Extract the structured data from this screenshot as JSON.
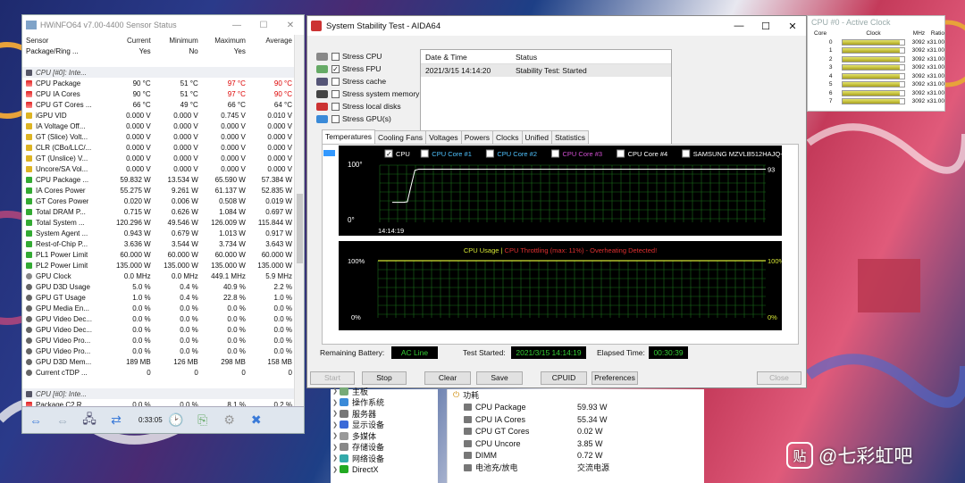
{
  "hwinfo": {
    "title": "HWiNFO64 v7.00-4400 Sensor Status",
    "cols": [
      "Sensor",
      "Current",
      "Minimum",
      "Maximum",
      "Average"
    ],
    "rows": [
      {
        "k": "h",
        "c": [
          "Package/Ring ...",
          "Yes",
          "No",
          "Yes",
          ""
        ]
      },
      {
        "k": "sp",
        "c": [
          "",
          "",
          "",
          "",
          ""
        ]
      },
      {
        "k": "g",
        "c": [
          "CPU [#0]: Inte...",
          "",
          "",
          "",
          ""
        ]
      },
      {
        "k": "t",
        "r": 1,
        "c": [
          "CPU Package",
          "90 °C",
          "51 °C",
          "97 °C",
          "90 °C"
        ]
      },
      {
        "k": "t",
        "r": 1,
        "c": [
          "CPU IA Cores",
          "90 °C",
          "51 °C",
          "97 °C",
          "90 °C"
        ]
      },
      {
        "k": "t",
        "c": [
          "CPU GT Cores ...",
          "66 °C",
          "49 °C",
          "66 °C",
          "64 °C"
        ]
      },
      {
        "k": "v",
        "c": [
          "iGPU VID",
          "0.000 V",
          "0.000 V",
          "0.745 V",
          "0.010 V"
        ]
      },
      {
        "k": "v",
        "c": [
          "IA Voltage Off...",
          "0.000 V",
          "0.000 V",
          "0.000 V",
          "0.000 V"
        ]
      },
      {
        "k": "v",
        "c": [
          "GT (Slice) Volt...",
          "0.000 V",
          "0.000 V",
          "0.000 V",
          "0.000 V"
        ]
      },
      {
        "k": "v",
        "c": [
          "CLR (CBo/LLC/...",
          "0.000 V",
          "0.000 V",
          "0.000 V",
          "0.000 V"
        ]
      },
      {
        "k": "v",
        "c": [
          "GT (Unslice) V...",
          "0.000 V",
          "0.000 V",
          "0.000 V",
          "0.000 V"
        ]
      },
      {
        "k": "v",
        "c": [
          "Uncore/SA Vol...",
          "0.000 V",
          "0.000 V",
          "0.000 V",
          "0.000 V"
        ]
      },
      {
        "k": "p",
        "c": [
          "CPU Package ...",
          "59.832 W",
          "13.534 W",
          "65.590 W",
          "57.384 W"
        ]
      },
      {
        "k": "p",
        "c": [
          "IA Cores Power",
          "55.275 W",
          "9.261 W",
          "61.137 W",
          "52.835 W"
        ]
      },
      {
        "k": "p",
        "c": [
          "GT Cores Power",
          "0.020 W",
          "0.006 W",
          "0.508 W",
          "0.019 W"
        ]
      },
      {
        "k": "p",
        "c": [
          "Total DRAM P...",
          "0.715 W",
          "0.626 W",
          "1.084 W",
          "0.697 W"
        ]
      },
      {
        "k": "p",
        "c": [
          "Total System ...",
          "120.296 W",
          "49.546 W",
          "126.009 W",
          "115.844 W"
        ]
      },
      {
        "k": "p",
        "c": [
          "System Agent ...",
          "0.943 W",
          "0.679 W",
          "1.013 W",
          "0.917 W"
        ]
      },
      {
        "k": "p",
        "c": [
          "Rest-of-Chip P...",
          "3.636 W",
          "3.544 W",
          "3.734 W",
          "3.643 W"
        ]
      },
      {
        "k": "p",
        "c": [
          "PL1 Power Limit",
          "60.000 W",
          "60.000 W",
          "60.000 W",
          "60.000 W"
        ]
      },
      {
        "k": "p",
        "c": [
          "PL2 Power Limit",
          "135.000 W",
          "135.000 W",
          "135.000 W",
          "135.000 W"
        ]
      },
      {
        "k": "c",
        "c": [
          "GPU Clock",
          "0.0 MHz",
          "0.0 MHz",
          "449.1 MHz",
          "5.9 MHz"
        ]
      },
      {
        "k": "u",
        "c": [
          "GPU D3D Usage",
          "5.0 %",
          "0.4 %",
          "40.9 %",
          "2.2 %"
        ]
      },
      {
        "k": "u",
        "c": [
          "GPU GT Usage",
          "1.0 %",
          "0.4 %",
          "22.8 %",
          "1.0 %"
        ]
      },
      {
        "k": "u",
        "c": [
          "GPU Media En...",
          "0.0 %",
          "0.0 %",
          "0.0 %",
          "0.0 %"
        ]
      },
      {
        "k": "u",
        "c": [
          "GPU Video Dec...",
          "0.0 %",
          "0.0 %",
          "0.0 %",
          "0.0 %"
        ]
      },
      {
        "k": "u",
        "c": [
          "GPU Video Dec...",
          "0.0 %",
          "0.0 %",
          "0.0 %",
          "0.0 %"
        ]
      },
      {
        "k": "u",
        "c": [
          "GPU Video Pro...",
          "0.0 %",
          "0.0 %",
          "0.0 %",
          "0.0 %"
        ]
      },
      {
        "k": "u",
        "c": [
          "GPU Video Pro...",
          "0.0 %",
          "0.0 %",
          "0.0 %",
          "0.0 %"
        ]
      },
      {
        "k": "u",
        "c": [
          "GPU D3D Mem...",
          "189 MB",
          "126 MB",
          "298 MB",
          "158 MB"
        ]
      },
      {
        "k": "u",
        "c": [
          "Current cTDP ...",
          "0",
          "0",
          "0",
          "0"
        ]
      },
      {
        "k": "sp",
        "c": [
          "",
          "",
          "",
          "",
          ""
        ]
      },
      {
        "k": "g",
        "c": [
          "CPU [#0]: Inte...",
          "",
          "",
          "",
          ""
        ]
      },
      {
        "k": "t",
        "c": [
          "Package C2 R...",
          "0.0 %",
          "0.0 %",
          "8.1 %",
          "0.2 %"
        ]
      }
    ],
    "timer": "0:33:05"
  },
  "clock": {
    "title": "CPU #0 - Active Clock",
    "cols": [
      "Core",
      "Clock",
      "MHz",
      "Ratio"
    ],
    "rows": [
      [
        "0",
        "3092",
        "x31.00"
      ],
      [
        "1",
        "3092",
        "x31.00"
      ],
      [
        "2",
        "3092",
        "x31.00"
      ],
      [
        "3",
        "3092",
        "x31.00"
      ],
      [
        "4",
        "3092",
        "x31.00"
      ],
      [
        "5",
        "3092",
        "x31.00"
      ],
      [
        "6",
        "3092",
        "x31.00"
      ],
      [
        "7",
        "3092",
        "x31.00"
      ]
    ]
  },
  "aida": {
    "title": "System Stability Test - AIDA64",
    "stress": [
      {
        "label": "Stress CPU",
        "checked": false
      },
      {
        "label": "Stress FPU",
        "checked": true
      },
      {
        "label": "Stress cache",
        "checked": false
      },
      {
        "label": "Stress system memory",
        "checked": false
      },
      {
        "label": "Stress local disks",
        "checked": false
      },
      {
        "label": "Stress GPU(s)",
        "checked": false
      }
    ],
    "log_cols": [
      "Date & Time",
      "Status"
    ],
    "log_rows": [
      [
        "2021/3/15 14:14:20",
        "Stability Test: Started"
      ]
    ],
    "tabs": [
      "Temperatures",
      "Cooling Fans",
      "Voltages",
      "Powers",
      "Clocks",
      "Unified",
      "Statistics"
    ],
    "legend": [
      {
        "label": "CPU",
        "color": "#ffffff",
        "checked": true
      },
      {
        "label": "CPU Core #1",
        "color": "#4fc3ff",
        "checked": false
      },
      {
        "label": "CPU Core #2",
        "color": "#4fc3ff",
        "checked": false
      },
      {
        "label": "CPU Core #3",
        "color": "#d24fd2",
        "checked": false
      },
      {
        "label": "CPU Core #4",
        "color": "#ffffff",
        "checked": false
      },
      {
        "label": "SAMSUNG MZVLB512HAJQ-00000",
        "color": "#ffffff",
        "checked": false
      }
    ],
    "temp_chart": {
      "ymax": "100",
      "yunit": "°C",
      "ymin": "0",
      "xlabel": "14:14:19",
      "value_label": "93",
      "series": [
        35,
        35,
        35,
        35,
        36,
        64,
        91,
        93,
        93,
        93,
        93,
        93,
        93,
        93,
        93,
        93,
        93,
        93,
        93,
        93,
        93,
        93,
        93,
        93,
        93,
        93,
        93,
        93,
        93,
        93,
        93,
        93,
        93,
        93,
        93,
        93,
        93,
        93,
        93,
        93,
        93,
        93,
        93,
        93,
        93,
        93,
        93,
        93,
        93,
        93,
        93,
        93,
        93,
        93,
        93,
        93,
        93,
        93,
        93,
        93,
        93,
        93,
        93,
        93,
        93,
        93,
        93,
        93,
        93,
        93,
        93,
        93,
        93,
        93,
        93,
        93,
        93,
        93,
        93,
        93,
        93,
        93,
        93,
        93,
        93,
        93,
        93,
        93,
        93,
        93,
        93,
        93,
        93,
        93,
        93,
        93,
        93,
        93,
        93,
        93
      ]
    },
    "usage_chart": {
      "title": "CPU Usage",
      "sep": "|",
      "throttle": "CPU Throttling (max: 11%) - Overheating Detected!",
      "top": "100%",
      "bottom": "0%",
      "series": [
        100,
        100,
        100,
        100,
        100,
        100,
        100,
        100,
        100,
        100,
        100,
        100,
        100,
        100,
        100,
        100,
        100,
        100,
        100,
        100
      ]
    },
    "remaining_battery_label": "Remaining Battery:",
    "remaining_battery": "AC Line",
    "test_started_label": "Test Started:",
    "test_started": "2021/3/15 14:14:19",
    "elapsed_label": "Elapsed Time:",
    "elapsed": "00:30:39",
    "buttons": [
      "Start",
      "Stop",
      "Clear",
      "Save",
      "CPUID",
      "Preferences",
      "Close"
    ]
  },
  "devices": [
    "主板",
    "操作系统",
    "服务器",
    "显示设备",
    "多媒体",
    "存储设备",
    "网络设备",
    "DirectX"
  ],
  "power": {
    "group": "功耗",
    "rows": [
      [
        "CPU Package",
        "59.93 W"
      ],
      [
        "CPU IA Cores",
        "55.34 W"
      ],
      [
        "CPU GT Cores",
        "0.02 W"
      ],
      [
        "CPU Uncore",
        "3.85 W"
      ],
      [
        "DIMM",
        "0.72 W"
      ],
      [
        "电池充/放电",
        "交流电源"
      ]
    ]
  },
  "watermark": {
    "logo": "贴",
    "text": "@七彩虹吧"
  },
  "colors": {
    "graph_bg": "#000000",
    "grid": "#1a6e1a",
    "lcd_text": "#33cc33",
    "temp_line": "#ffffff",
    "usage_line": "#d6e635",
    "throttle": "#e03030"
  }
}
